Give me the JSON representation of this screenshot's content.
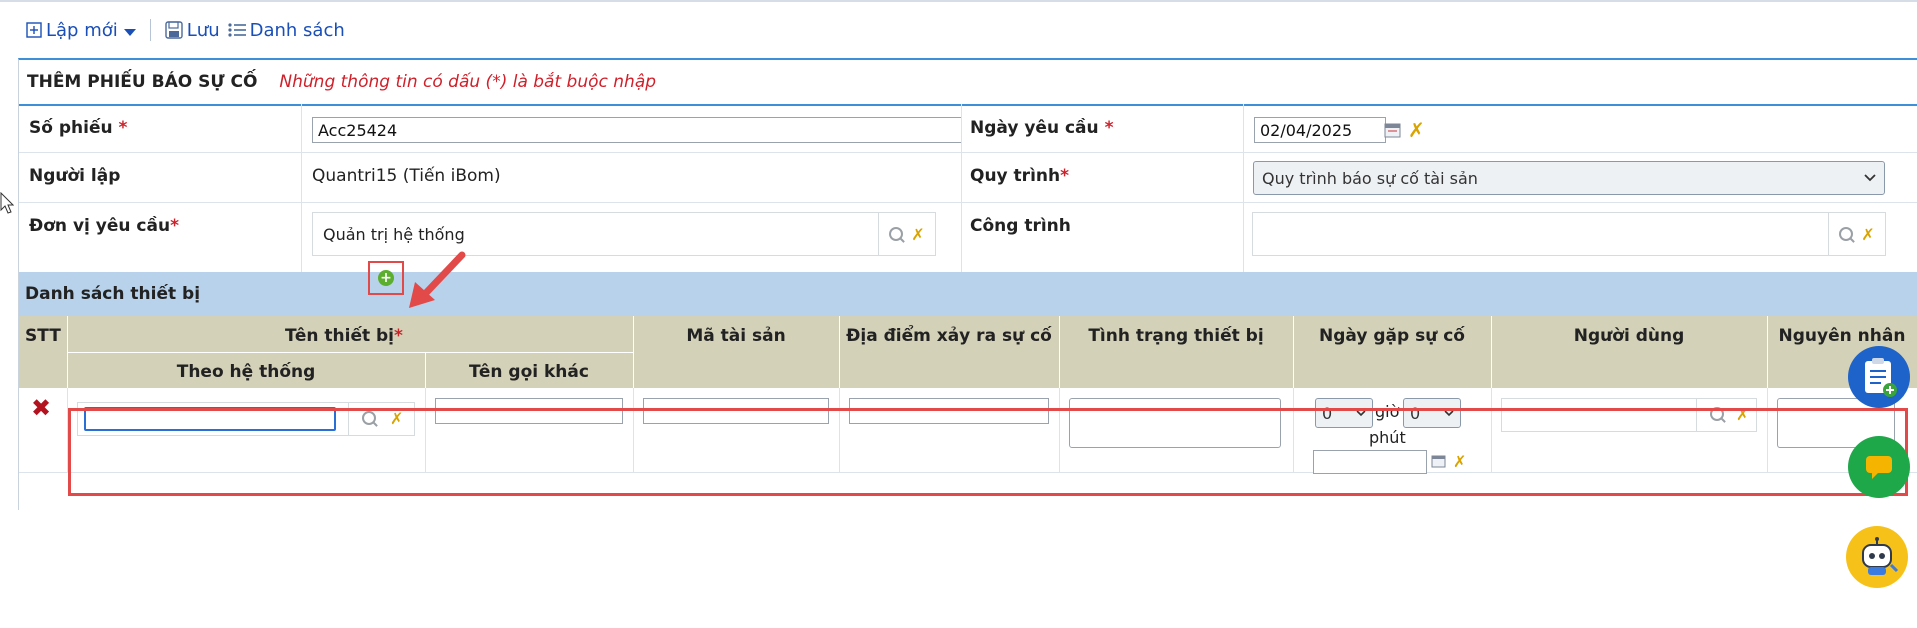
{
  "toolbar": {
    "new_label": "Lập mới",
    "save_label": "Lưu",
    "list_label": "Danh sách"
  },
  "form": {
    "title": "THÊM PHIẾU BÁO SỰ CỐ",
    "required_note": "Những thông tin có dấu (*) là bắt buộc nhập",
    "so_phieu_label": "Số phiếu",
    "so_phieu_value": "Acc25424",
    "ngay_yeu_cau_label": "Ngày yêu cầu",
    "ngay_yeu_cau_value": "02/04/2025",
    "nguoi_lap_label": "Người lập",
    "nguoi_lap_value": "Quantri15 (Tiến iBom)",
    "quy_trinh_label": "Quy trình",
    "quy_trinh_value": "Quy trình báo sự cố tài sản",
    "don_vi_label": "Đơn vị yêu cầu",
    "don_vi_value": "Quản trị hệ thống",
    "cong_trinh_label": "Công trình",
    "cong_trinh_value": "",
    "required_mark": "*"
  },
  "device_list": {
    "title": "Danh sách thiết bị",
    "columns": {
      "stt": "STT",
      "ten_thiet_bi": "Tên thiết bị",
      "theo_he_thong": "Theo hệ thống",
      "ten_goi_khac": "Tên gọi khác",
      "ma_tai_san": "Mã tài sản",
      "dia_diem": "Địa điểm xảy ra sự cố",
      "tinh_trang": "Tình trạng thiết bị",
      "ngay_gap_su_co": "Ngày gặp sự cố",
      "nguoi_dung": "Người dùng",
      "nguyen_nhan": "Nguyên nhân"
    },
    "row": {
      "hour_value": "0",
      "minute_value": "0",
      "hour_label": "giờ",
      "minute_label": "phút"
    }
  },
  "colors": {
    "link_blue": "#1a4fb8",
    "required_red": "#d0202a",
    "section_bg": "#b8d2eb",
    "header_bg": "#d3d1b8",
    "highlight_red": "#e14a48"
  }
}
